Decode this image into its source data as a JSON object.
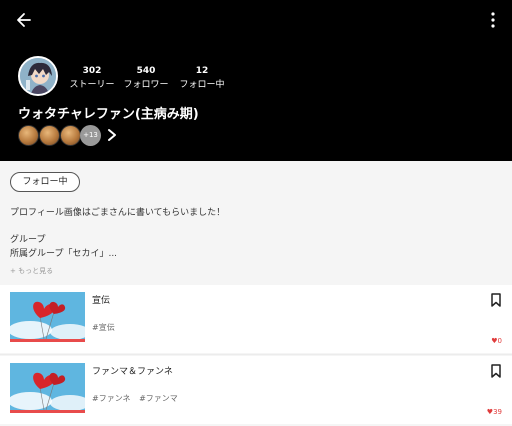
{
  "profile": {
    "username": "ウォタチャレファン(主病み期)",
    "stats": [
      {
        "value": "302",
        "label": "ストーリー"
      },
      {
        "value": "540",
        "label": "フォロワー"
      },
      {
        "value": "12",
        "label": "フォロー中"
      }
    ],
    "badges_extra": "+13",
    "follow_button": "フォロー中",
    "bio_line1": "プロフィール画像はごまさんに書いてもらいました！",
    "bio_line2": "グループ",
    "bio_line3": "所属グループ「セカイ」...",
    "more_link": "+ もっと見る"
  },
  "stories": [
    {
      "title": "宣伝",
      "tags": [
        "#宣伝"
      ],
      "likes": "0"
    },
    {
      "title": "ファンマ＆ファンネ",
      "tags": [
        "#ファンネ",
        "#ファンマ"
      ],
      "likes": "39"
    }
  ],
  "colors": {
    "header_bg": "#000000",
    "like_red": "#e03c3c",
    "thumb_bar": "#e84b4b"
  }
}
